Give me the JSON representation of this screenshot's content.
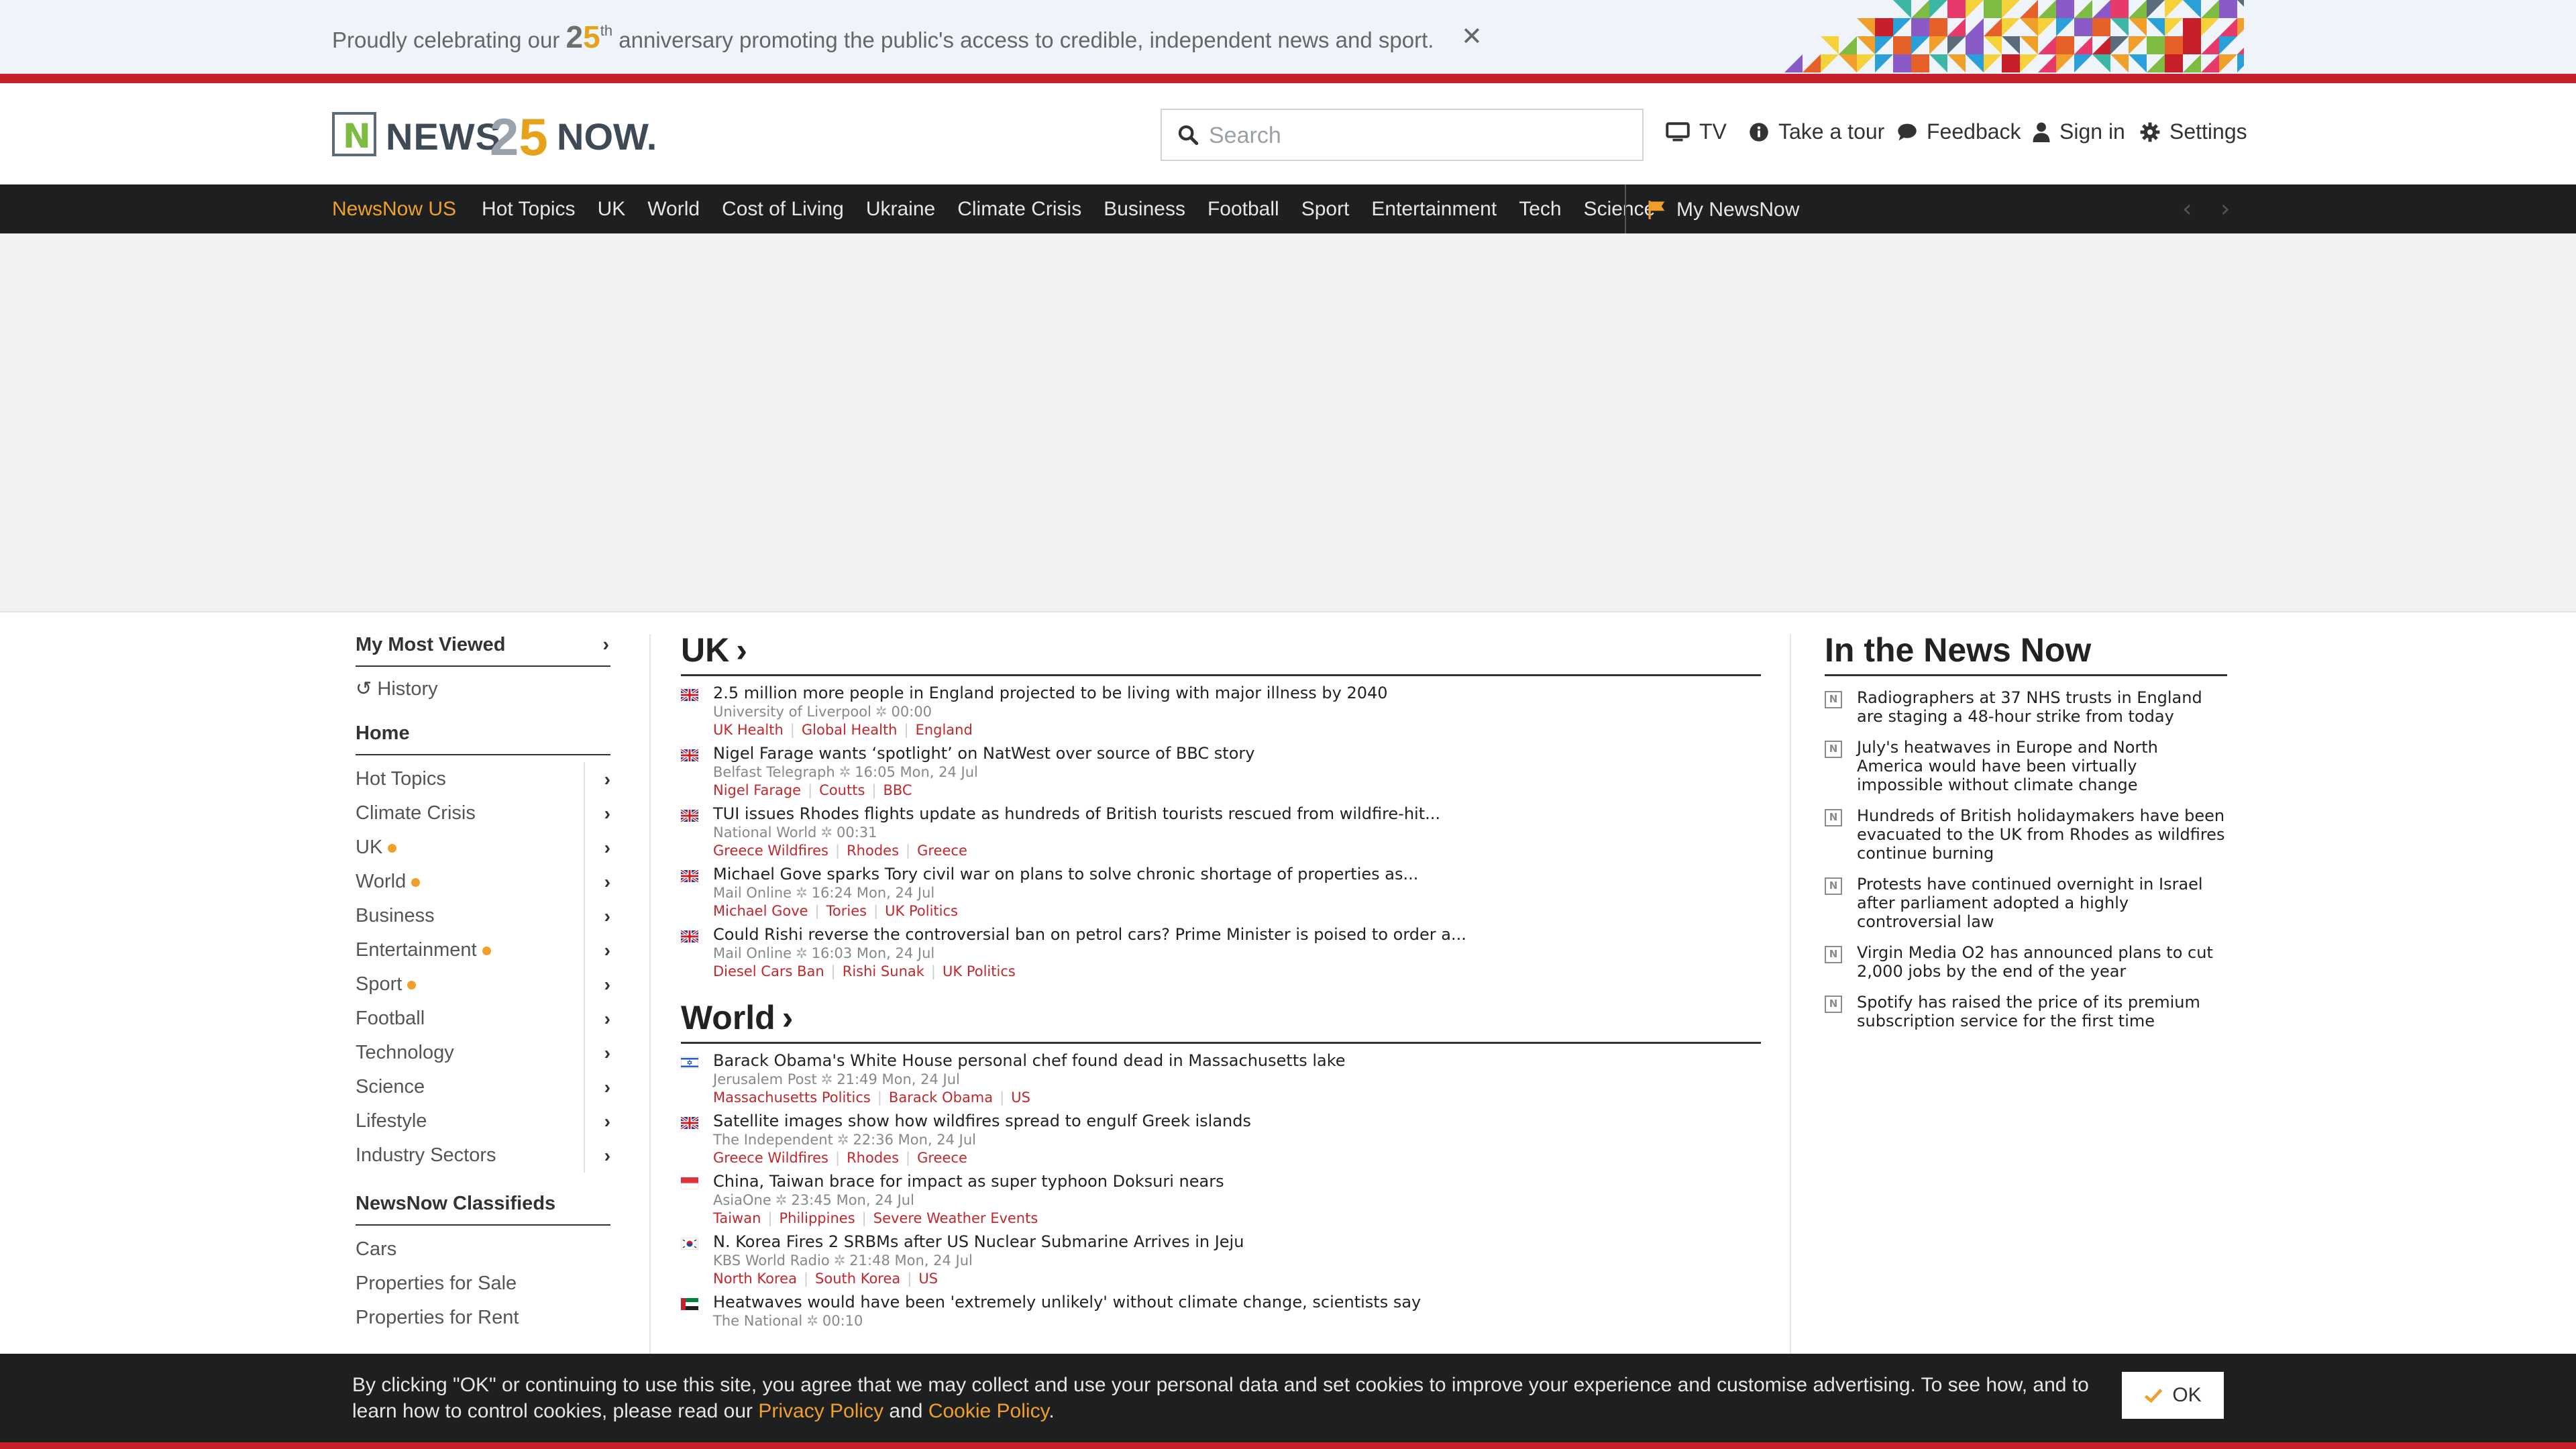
{
  "banner": {
    "text_before": "Proudly celebrating our",
    "anniversary_number": "25",
    "anniversary_suffix": "th",
    "text_after": "anniversary promoting the public's access to credible, independent news and sport."
  },
  "header": {
    "logo_left": "NEWS",
    "logo_number": "25",
    "logo_right": "NOW.",
    "logo_mark": "N",
    "search_placeholder": "Search",
    "nav": [
      {
        "label": "TV",
        "icon": "tv-icon"
      },
      {
        "label": "Take a tour",
        "icon": "info-icon"
      },
      {
        "label": "Feedback",
        "icon": "comment-icon"
      },
      {
        "label": "Sign in",
        "icon": "user-icon"
      },
      {
        "label": "Settings",
        "icon": "gear-icon"
      }
    ]
  },
  "topnav": {
    "active": "NewsNow US",
    "items": [
      "Hot Topics",
      "UK",
      "World",
      "Cost of Living",
      "Ukraine",
      "Climate Crisis",
      "Business",
      "Football",
      "Sport",
      "Entertainment",
      "Tech",
      "Science"
    ],
    "my_newsnow": "My NewsNow"
  },
  "sidebar": {
    "most_viewed": "My Most Viewed",
    "history": "History",
    "home": "Home",
    "items": [
      {
        "label": "Hot Topics",
        "dot": false
      },
      {
        "label": "Climate Crisis",
        "dot": false
      },
      {
        "label": "UK",
        "dot": true
      },
      {
        "label": "World",
        "dot": true
      },
      {
        "label": "Business",
        "dot": false
      },
      {
        "label": "Entertainment",
        "dot": true
      },
      {
        "label": "Sport",
        "dot": true
      },
      {
        "label": "Football",
        "dot": false
      },
      {
        "label": "Technology",
        "dot": false
      },
      {
        "label": "Science",
        "dot": false
      },
      {
        "label": "Lifestyle",
        "dot": false
      },
      {
        "label": "Industry Sectors",
        "dot": false
      }
    ],
    "classifieds_title": "NewsNow Classifieds",
    "classifieds": [
      "Cars",
      "Properties for Sale",
      "Properties for Rent"
    ]
  },
  "main": {
    "sections": [
      {
        "title": "UK",
        "articles": [
          {
            "flag": "uk",
            "headline": "2.5 million more people in England projected to be living with major illness by 2040",
            "source": "University of Liverpool",
            "time": "00:00",
            "tags": [
              "UK Health",
              "Global Health",
              "England"
            ]
          },
          {
            "flag": "uk",
            "headline": "Nigel Farage wants ‘spotlight’ on NatWest over source of BBC story",
            "source": "Belfast Telegraph",
            "time": "16:05 Mon, 24 Jul",
            "tags": [
              "Nigel Farage",
              "Coutts",
              "BBC"
            ]
          },
          {
            "flag": "uk",
            "headline": "TUI issues Rhodes flights update as hundreds of British tourists rescued from wildfire-hit...",
            "source": "National World",
            "time": "00:31",
            "tags": [
              "Greece Wildfires",
              "Rhodes",
              "Greece"
            ]
          },
          {
            "flag": "uk",
            "headline": "Michael Gove sparks Tory civil war on plans to solve chronic shortage of properties as...",
            "source": "Mail Online",
            "time": "16:24 Mon, 24 Jul",
            "tags": [
              "Michael Gove",
              "Tories",
              "UK Politics"
            ]
          },
          {
            "flag": "uk",
            "headline": "Could Rishi reverse the controversial ban on petrol cars? Prime Minister is poised to order a...",
            "source": "Mail Online",
            "time": "16:03 Mon, 24 Jul",
            "tags": [
              "Diesel Cars Ban",
              "Rishi Sunak",
              "UK Politics"
            ]
          }
        ]
      },
      {
        "title": "World",
        "articles": [
          {
            "flag": "il",
            "headline": "Barack Obama's White House personal chef found dead in Massachusetts lake",
            "source": "Jerusalem Post",
            "time": "21:49 Mon, 24 Jul",
            "tags": [
              "Massachusetts Politics",
              "Barack Obama",
              "US"
            ]
          },
          {
            "flag": "uk",
            "headline": "Satellite images show how wildfires spread to engulf Greek islands",
            "source": "The Independent",
            "time": "22:36 Mon, 24 Jul",
            "tags": [
              "Greece Wildfires",
              "Rhodes",
              "Greece"
            ]
          },
          {
            "flag": "sg",
            "headline": "China, Taiwan brace for impact as super typhoon Doksuri nears",
            "source": "AsiaOne",
            "time": "23:45 Mon, 24 Jul",
            "tags": [
              "Taiwan",
              "Philippines",
              "Severe Weather Events"
            ]
          },
          {
            "flag": "kr",
            "headline": "N. Korea Fires 2 SRBMs after US Nuclear Submarine Arrives in Jeju",
            "source": "KBS World Radio",
            "time": "21:48 Mon, 24 Jul",
            "tags": [
              "North Korea",
              "South Korea",
              "US"
            ]
          },
          {
            "flag": "ae",
            "headline": "Heatwaves would have been 'extremely unlikely' without climate change, scientists say",
            "source": "The National",
            "time": "00:10",
            "tags": []
          }
        ]
      }
    ]
  },
  "right": {
    "title": "In the News Now",
    "items": [
      "Radiographers at 37 NHS trusts in England are staging a 48-hour strike from today",
      "July's heatwaves in Europe and North America would have been virtually impossible without climate change",
      "Hundreds of British holidaymakers have been evacuated to the UK from Rhodes as wildfires continue burning",
      "Protests have continued overnight in Israel after parliament adopted a highly controversial law",
      "Virgin Media O2 has announced plans to cut 2,000 jobs by the end of the year",
      "Spotify has raised the price of its premium subscription service for the first time"
    ]
  },
  "cookie": {
    "text_before": "By clicking \"OK\" or continuing to use this site, you agree that we may collect and use your personal data and set cookies to improve your experience and customise advertising. To see how, and to learn how to control cookies, please read our",
    "privacy_link": "Privacy Policy",
    "and": "and",
    "cookie_link": "Cookie Policy",
    "period": ".",
    "ok_label": "OK"
  },
  "colors": {
    "accent_orange": "#f0a02a",
    "brand_red": "#c8202a",
    "tag_red": "#c0282d",
    "nav_dark": "#1d1f21"
  }
}
